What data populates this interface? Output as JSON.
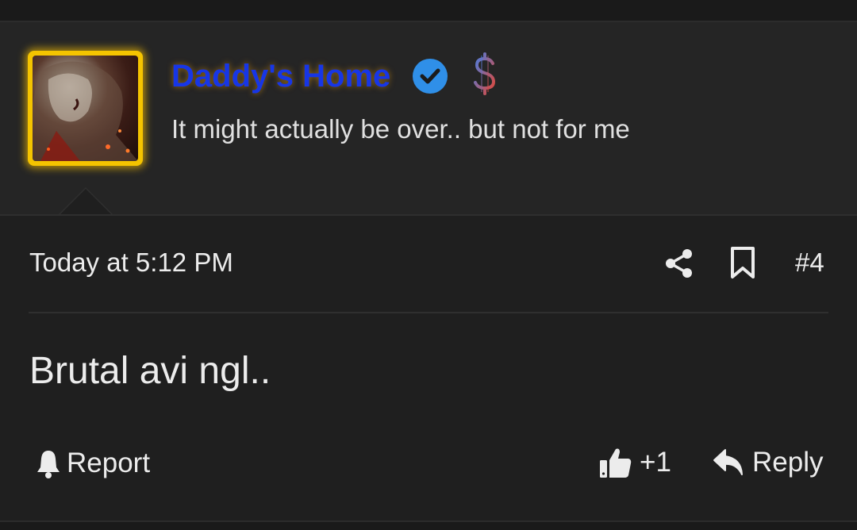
{
  "post": {
    "author": {
      "username": "Daddy's Home",
      "tagline": "It might actually be over.. but not for me",
      "verified_icon": "verified-check-icon",
      "badge_icon": "dollar-sign-icon",
      "avatar_border_color": "#f5c400",
      "username_color": "#1736e6"
    },
    "timestamp": "Today at 5:12 PM",
    "post_number": "#4",
    "content": "Brutal avi ngl..",
    "actions": {
      "report_label": "Report",
      "like_label": "+1",
      "reply_label": "Reply"
    }
  }
}
